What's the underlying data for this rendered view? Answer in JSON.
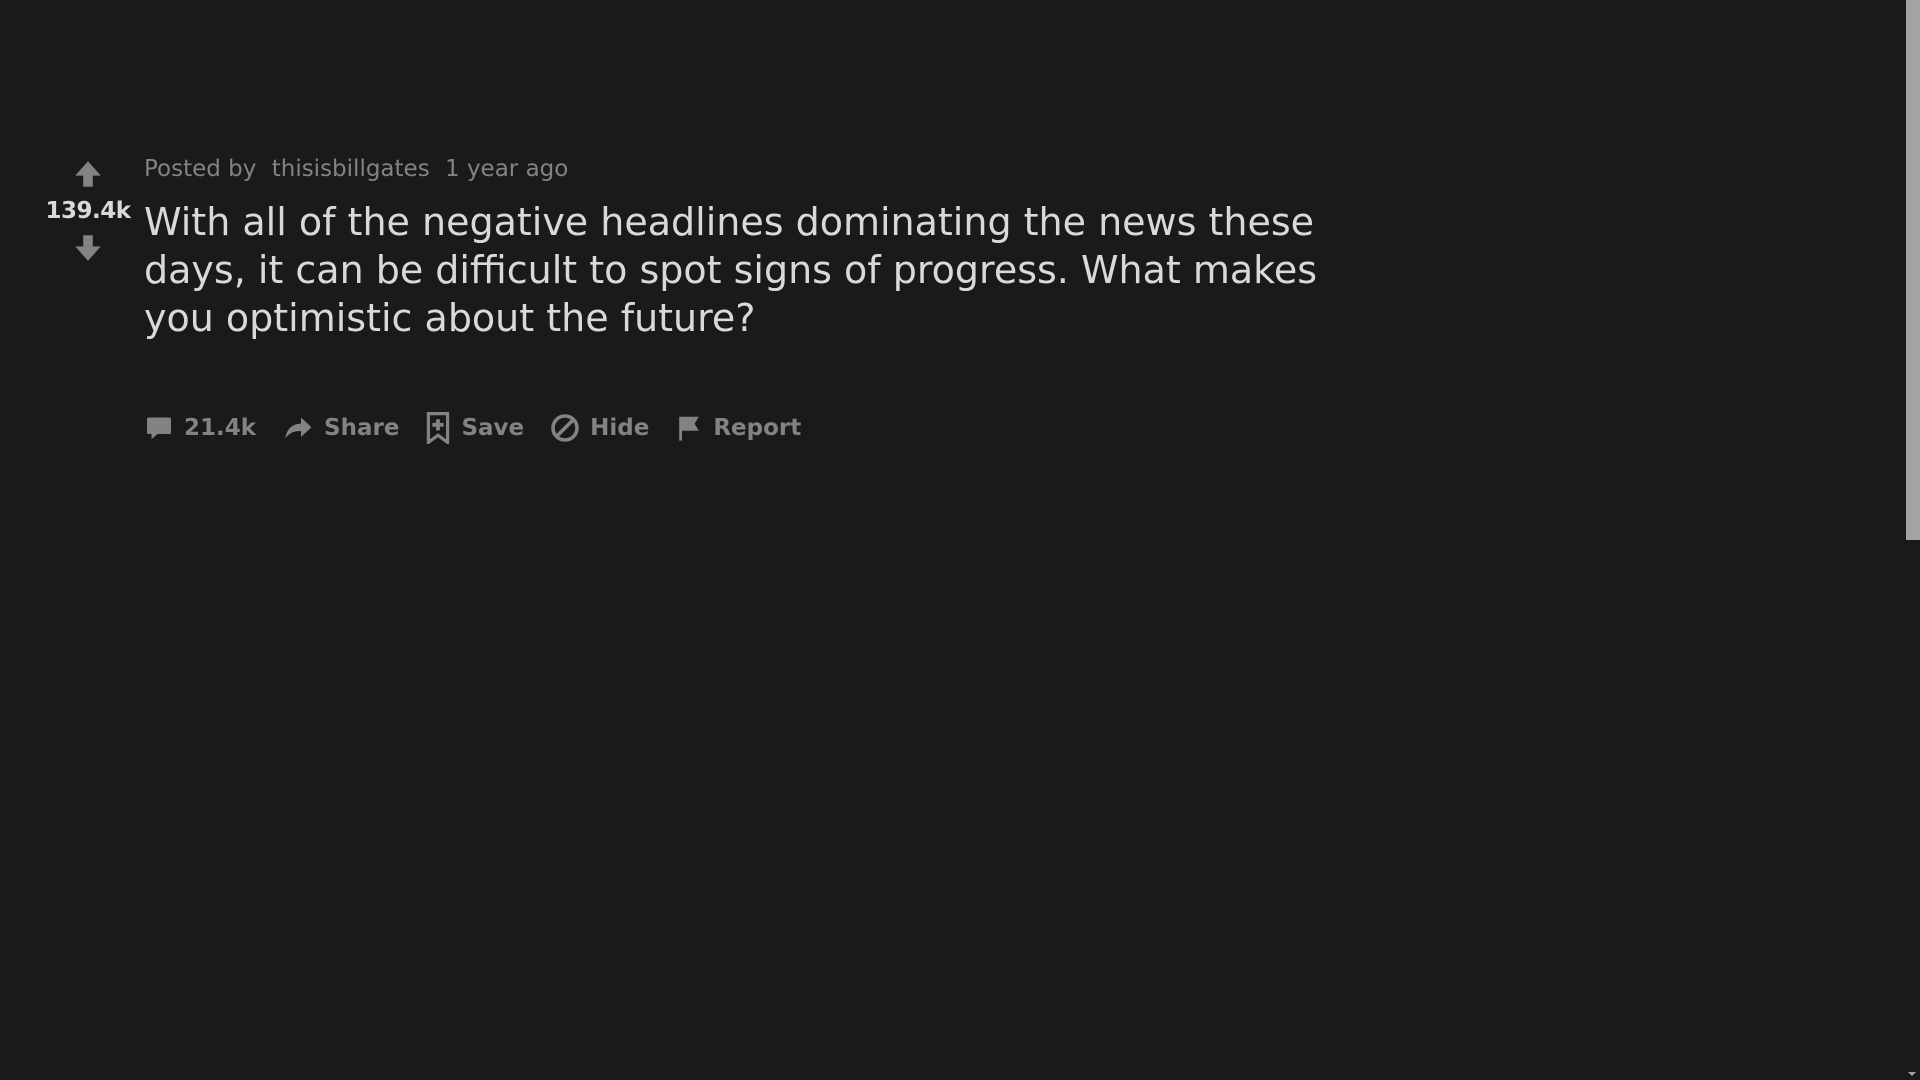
{
  "post": {
    "votes": "139.4k",
    "posted_by_label": "Posted by",
    "author": "thisisbillgates",
    "time": "1 year ago",
    "title": "With all of the negative headlines dominating the news these days, it can be difficult to spot signs of progress. What makes you optimistic about the future?",
    "actions": {
      "comments": "21.4k",
      "share": "Share",
      "save": "Save",
      "hide": "Hide",
      "report": "Report"
    }
  },
  "icons": {
    "upvote": "arrow-up-icon",
    "downvote": "arrow-down-icon",
    "comments": "comment-bubble-icon",
    "share": "share-arrow-icon",
    "save": "bookmark-plus-icon",
    "hide": "prohibit-icon",
    "report": "flag-icon"
  },
  "colors": {
    "background": "#1a1a1b",
    "text": "#d7dadc",
    "muted": "#818384",
    "scrollbar_thumb": "#a3a3a3"
  }
}
